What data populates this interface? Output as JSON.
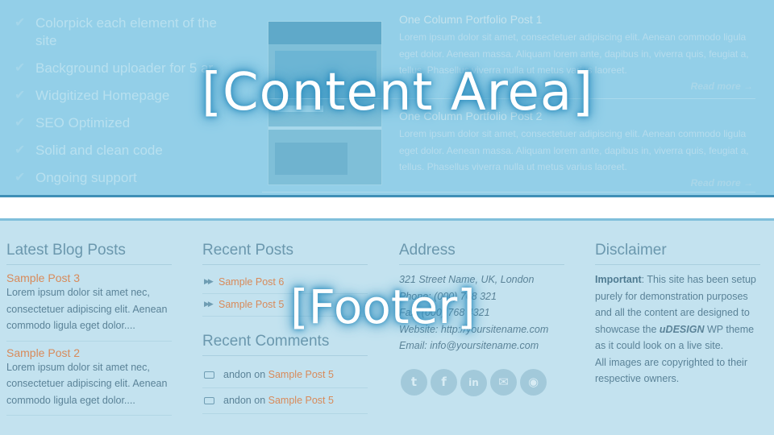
{
  "overlays": {
    "content": "[Content Area]",
    "footer": "[Footer]"
  },
  "content": {
    "features": [
      "Colorpick each element of the site",
      "Background uploader for 5 ar",
      "Widgitized Homepage",
      "SEO Optimized",
      "Solid and clean code",
      "Ongoing support"
    ],
    "posts": [
      {
        "title": "One Column Portfolio Post 1",
        "body": "Lorem ipsum dolor sit amet, consectetuer adipiscing elit. Aenean commodo ligula eget dolor. Aenean massa. Aliquam lorem ante, dapibus in, viverra quis, feugiat a, tellus. Phasellus viverra nulla ut metus varius laoreet.",
        "read_more": "Read more →"
      },
      {
        "title": "One Column Portfolio Post 2",
        "body": "Lorem ipsum dolor sit amet, consectetuer adipiscing elit. Aenean commodo ligula eget dolor. Aenean massa. Aliquam lorem ante, dapibus in, viverra quis, feugiat a, tellus. Phasellus viverra nulla ut metus varius laoreet.",
        "read_more": "Read more →"
      }
    ]
  },
  "footer": {
    "latest_blog": {
      "heading": "Latest Blog Posts",
      "items": [
        {
          "title": "Sample Post 3",
          "excerpt": "Lorem ipsum dolor sit amet nec, consectetuer adipiscing elit. Aenean commodo ligula eget dolor...."
        },
        {
          "title": "Sample Post 2",
          "excerpt": "Lorem ipsum dolor sit amet nec, consectetuer adipiscing elit. Aenean commodo ligula eget dolor...."
        }
      ]
    },
    "recent_posts": {
      "heading": "Recent Posts",
      "items": [
        "Sample Post 6",
        "Sample Post 5"
      ]
    },
    "recent_comments": {
      "heading": "Recent Comments",
      "items": [
        {
          "author": "andon",
          "on": "on",
          "post": "Sample Post 5"
        },
        {
          "author": "andon",
          "on": "on",
          "post": "Sample Post 5"
        }
      ]
    },
    "address": {
      "heading": "Address",
      "lines": [
        "321 Street Name, UK, London",
        "Phone: (000) 768 321",
        "Fax: (000) 768 4321"
      ],
      "website": "Website: http://yoursitename.com",
      "email": "Email: info@yoursitename.com",
      "social": [
        {
          "icon": "twitter-icon",
          "glyph": "t"
        },
        {
          "icon": "facebook-icon",
          "glyph": "f"
        },
        {
          "icon": "linkedin-icon",
          "glyph": "in"
        },
        {
          "icon": "mail-icon",
          "glyph": "✉"
        },
        {
          "icon": "rss-icon",
          "glyph": "◉"
        }
      ]
    },
    "disclaimer": {
      "heading": "Disclaimer",
      "important": "Important",
      "text1": ": This site has been setup purely for demonstration purposes and all the content are designed to showcase the ",
      "brand": "uDESIGN",
      "text2": " WP theme as it could look on a live site.",
      "text3": "All images are copyrighted to their respective owners."
    }
  },
  "colors": {
    "link": "#d88a5a",
    "accent_rule": "#3f8fb6",
    "overlay_glow": "#2f8fbf"
  }
}
